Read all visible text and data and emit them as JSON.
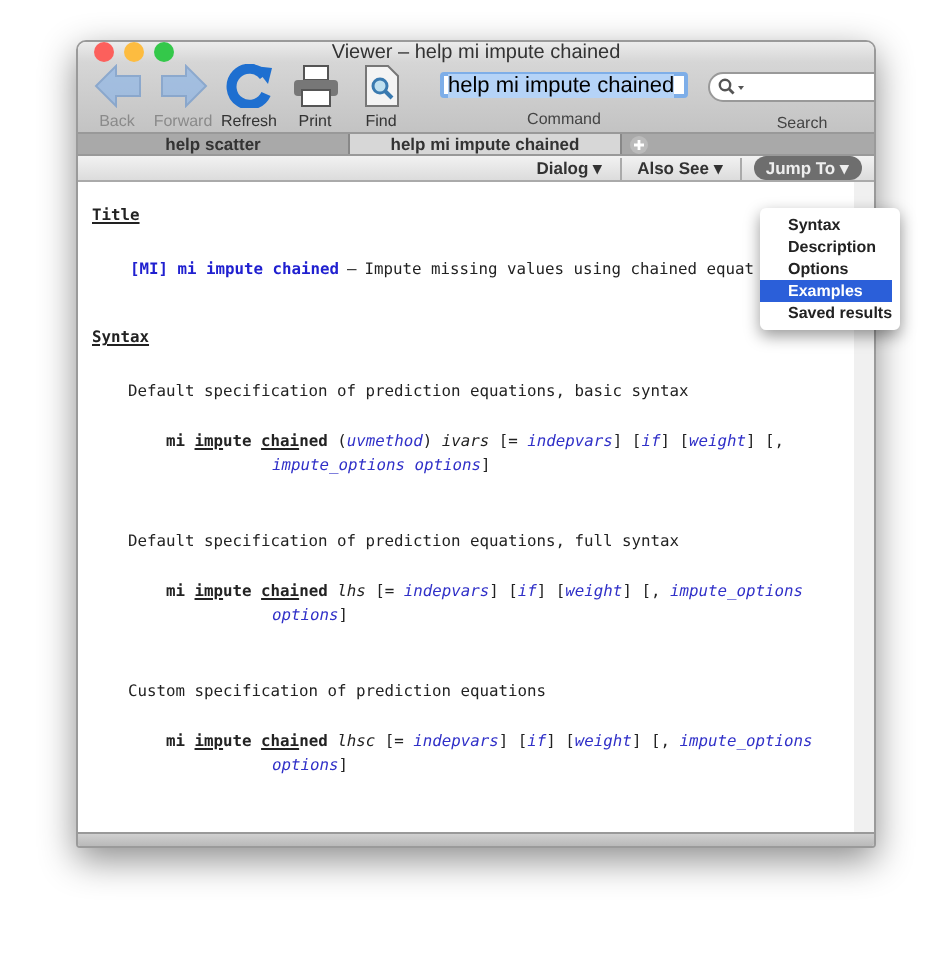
{
  "window": {
    "title": "Viewer – help mi impute chained"
  },
  "toolbar": {
    "buttons": [
      {
        "label": "Back",
        "kind": "back",
        "disabled": true
      },
      {
        "label": "Forward",
        "kind": "forward",
        "disabled": true
      },
      {
        "label": "Refresh",
        "kind": "refresh",
        "disabled": false
      },
      {
        "label": "Print",
        "kind": "print",
        "disabled": false
      },
      {
        "label": "Find",
        "kind": "find",
        "disabled": false
      }
    ],
    "command": {
      "value": "help mi impute chained",
      "label": "Command"
    },
    "search": {
      "label": "Search"
    }
  },
  "tabs": [
    {
      "label": "help scatter",
      "selected": false
    },
    {
      "label": "help mi impute chained",
      "selected": true
    }
  ],
  "subbar": {
    "buttons": [
      {
        "label": "Dialog ▾",
        "kind": "plain"
      },
      {
        "label": "Also See ▾",
        "kind": "plain"
      },
      {
        "label": "Jump To ▾",
        "kind": "pill"
      }
    ]
  },
  "jump_menu": {
    "items": [
      {
        "label": "Syntax",
        "selected": false
      },
      {
        "label": "Description",
        "selected": false
      },
      {
        "label": "Options",
        "selected": false
      },
      {
        "label": "Examples",
        "selected": true
      },
      {
        "label": "Saved results",
        "selected": false
      }
    ]
  },
  "content": [
    {
      "kind": "heading",
      "text": "Title"
    },
    {
      "kind": "entry",
      "link": "[MI] mi impute chained",
      "dash": "—",
      "text": "Impute missing values using chained equat"
    },
    {
      "kind": "heading",
      "text": "Syntax"
    },
    {
      "kind": "text",
      "text": "Default specification of prediction equations, basic syntax"
    },
    {
      "kind": "syntax",
      "lines": [
        [
          {
            "kind": "cmd",
            "text": "mi "
          },
          {
            "kind": "abbr",
            "text": "imp"
          },
          {
            "kind": "cmd",
            "text": "ute "
          },
          {
            "kind": "abbr",
            "text": "chai"
          },
          {
            "kind": "cmd",
            "text": "ned"
          },
          {
            "kind": "plain",
            "text": " ("
          },
          {
            "kind": "arg",
            "text": "uvmethod"
          },
          {
            "kind": "plain",
            "text": ") "
          },
          {
            "kind": "var",
            "text": "ivars"
          },
          {
            "kind": "plain",
            "text": " [= "
          },
          {
            "kind": "arg",
            "text": "indepvars"
          },
          {
            "kind": "plain",
            "text": "] ["
          },
          {
            "kind": "arg",
            "text": "if"
          },
          {
            "kind": "plain",
            "text": "] ["
          },
          {
            "kind": "arg",
            "text": "weight"
          },
          {
            "kind": "plain",
            "text": "] [,"
          }
        ],
        [
          {
            "kind": "arg",
            "text": "impute_options options"
          },
          {
            "kind": "plain",
            "text": "]"
          }
        ]
      ]
    },
    {
      "kind": "text",
      "text": "Default specification of prediction equations, full syntax"
    },
    {
      "kind": "syntax",
      "lines": [
        [
          {
            "kind": "cmd",
            "text": "mi "
          },
          {
            "kind": "abbr",
            "text": "imp"
          },
          {
            "kind": "cmd",
            "text": "ute "
          },
          {
            "kind": "abbr",
            "text": "chai"
          },
          {
            "kind": "cmd",
            "text": "ned "
          },
          {
            "kind": "var",
            "text": "lhs"
          },
          {
            "kind": "plain",
            "text": " [= "
          },
          {
            "kind": "arg",
            "text": "indepvars"
          },
          {
            "kind": "plain",
            "text": "] ["
          },
          {
            "kind": "arg",
            "text": "if"
          },
          {
            "kind": "plain",
            "text": "] ["
          },
          {
            "kind": "arg",
            "text": "weight"
          },
          {
            "kind": "plain",
            "text": "] [, "
          },
          {
            "kind": "arg",
            "text": "impute_options"
          }
        ],
        [
          {
            "kind": "arg",
            "text": "options"
          },
          {
            "kind": "plain",
            "text": "]"
          }
        ]
      ]
    },
    {
      "kind": "text",
      "text": "Custom specification of prediction equations"
    },
    {
      "kind": "syntax",
      "lines": [
        [
          {
            "kind": "cmd",
            "text": "mi "
          },
          {
            "kind": "abbr",
            "text": "imp"
          },
          {
            "kind": "cmd",
            "text": "ute "
          },
          {
            "kind": "abbr",
            "text": "chai"
          },
          {
            "kind": "cmd",
            "text": "ned "
          },
          {
            "kind": "var",
            "text": "lhsc"
          },
          {
            "kind": "plain",
            "text": " [= "
          },
          {
            "kind": "arg",
            "text": "indepvars"
          },
          {
            "kind": "plain",
            "text": "] ["
          },
          {
            "kind": "arg",
            "text": "if"
          },
          {
            "kind": "plain",
            "text": "] ["
          },
          {
            "kind": "arg",
            "text": "weight"
          },
          {
            "kind": "plain",
            "text": "] [, "
          },
          {
            "kind": "arg",
            "text": "impute_options"
          }
        ],
        [
          {
            "kind": "arg",
            "text": "options"
          },
          {
            "kind": "plain",
            "text": "]"
          }
        ]
      ]
    }
  ]
}
